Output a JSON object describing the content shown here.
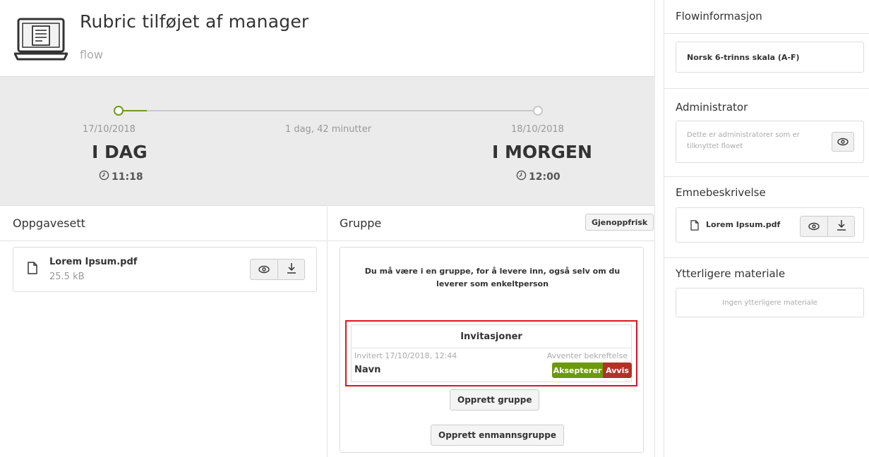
{
  "header": {
    "title": "Rubric tilføjet af manager",
    "subtitle": "flow",
    "icon": "laptop-document-icon"
  },
  "timeline": {
    "start_date": "17/10/2018",
    "start_label": "I DAG",
    "start_time": "11:18",
    "duration": "1 dag, 42 minutter",
    "end_date": "18/10/2018",
    "end_label": "I MORGEN",
    "end_time": "12:00",
    "progress_color": "#6f9a1c"
  },
  "oppgavesett": {
    "title": "Oppgavesett",
    "file": {
      "name": "Lorem Ipsum.pdf",
      "size": "25.5 kB"
    }
  },
  "gruppe": {
    "title": "Gruppe",
    "refresh_label": "Gjenoppfrisk",
    "message": "Du må være i en gruppe, for å levere inn, også selv om du leverer som enkeltperson",
    "invitations": {
      "title": "Invitasjoner",
      "invited": "Invitert 17/10/2018, 12:44",
      "name": "Navn",
      "status": "Avventer bekreftelse",
      "accept_label": "Aksepterer",
      "reject_label": "Avvis"
    },
    "create_group_label": "Opprett gruppe",
    "create_single_label": "Opprett enmannsgruppe"
  },
  "sidebar": {
    "flowinfo_title": "Flowinformasjon",
    "scale": "Norsk 6-trinns skala (A-F)",
    "admin_title": "Administrator",
    "admin_text": "Dette er administratorer som er tilknyttet flowet",
    "topic_title": "Emnebeskrivelse",
    "topic_file": "Lorem Ipsum.pdf",
    "extra_title": "Ytterligere materiale",
    "extra_empty": "Ingen ytterligere materiale"
  },
  "colors": {
    "accept": "#6b9a0e",
    "reject": "#b23227",
    "highlight": "#e0141c"
  }
}
